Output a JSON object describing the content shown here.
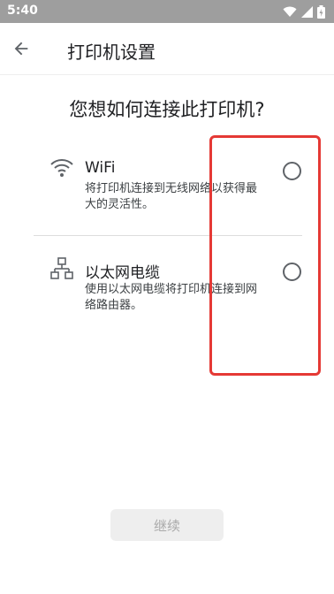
{
  "status_bar": {
    "time": "5:40",
    "icons": [
      "wifi-icon",
      "cellular-signal-icon",
      "battery-icon"
    ]
  },
  "app_bar": {
    "title": "打印机设置",
    "back_icon": "arrow-back-icon"
  },
  "question": "您想如何连接此打印机?",
  "options": [
    {
      "title": "WiFi",
      "description": "将打印机连接到无线网络以获得最大的灵活性。",
      "icon": "wifi-icon",
      "selected": false
    },
    {
      "title": "以太网电缆",
      "description": "使用以太网电缆将打印机连接到网络路由器。",
      "icon": "ethernet-network-icon",
      "selected": false
    }
  ],
  "continue_button": {
    "label": "继续",
    "enabled": false
  },
  "colors": {
    "status_bar_bg": "#9e9e9e",
    "highlight_border": "#e53935",
    "radio_border": "#5f6368",
    "disabled_button_bg": "#eeeeee"
  }
}
